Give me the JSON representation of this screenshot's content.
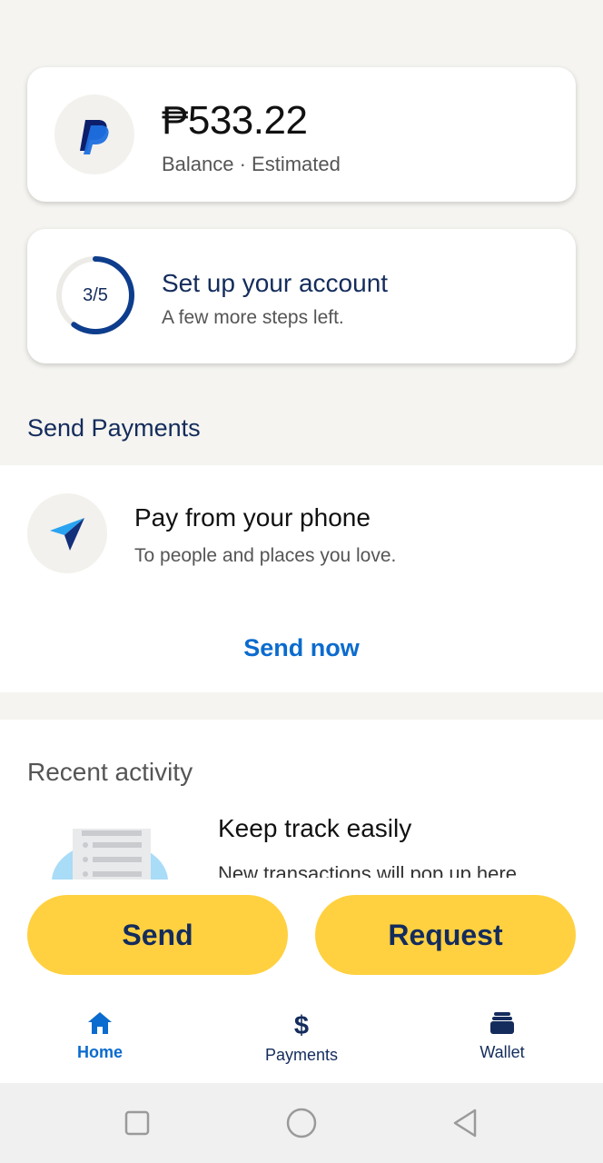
{
  "balance": {
    "amount": "₱533.22",
    "label": "Balance · Estimated"
  },
  "setup": {
    "progress_text": "3/5",
    "progress_fraction": 0.6,
    "title": "Set up your account",
    "subtitle": "A few more steps left."
  },
  "send_payments": {
    "heading": "Send Payments",
    "title": "Pay from your phone",
    "subtitle": "To people and places you love.",
    "action": "Send now"
  },
  "recent_activity": {
    "heading": "Recent activity",
    "title": "Keep track easily",
    "subtitle": "New transactions will pop up here"
  },
  "actions": {
    "send": "Send",
    "request": "Request"
  },
  "nav": {
    "home": "Home",
    "payments": "Payments",
    "wallet": "Wallet"
  },
  "icons": {
    "logo": "paypal-logo-icon",
    "plane": "paper-plane-icon",
    "home": "home-icon",
    "dollar": "dollar-icon",
    "wallet": "wallet-icon"
  },
  "colors": {
    "brand_navy": "#142c5c",
    "link_blue": "#0b6bce",
    "button_yellow": "#ffd140",
    "background": "#f5f4f0"
  }
}
